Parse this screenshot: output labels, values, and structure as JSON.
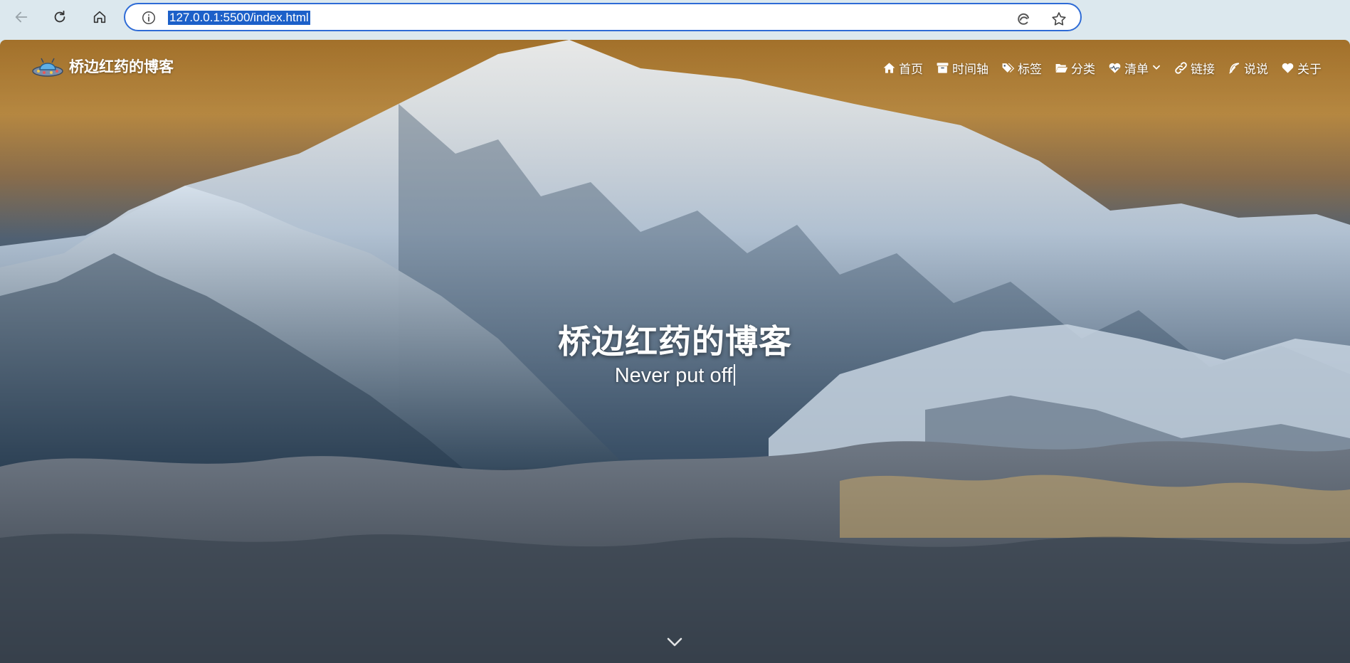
{
  "browser": {
    "url": "127.0.0.1:5500/index.html"
  },
  "site": {
    "title": "桥边红药的博客"
  },
  "menu": {
    "items": [
      {
        "label": "首页",
        "icon": "home-icon"
      },
      {
        "label": "时间轴",
        "icon": "archive-icon"
      },
      {
        "label": "标签",
        "icon": "tags-icon"
      },
      {
        "label": "分类",
        "icon": "folder-open-icon"
      },
      {
        "label": "清单",
        "icon": "heartbeat-icon"
      },
      {
        "label": "链接",
        "icon": "link-icon"
      },
      {
        "label": "说说",
        "icon": "feather-icon"
      },
      {
        "label": "关于",
        "icon": "heart-icon"
      }
    ]
  },
  "hero": {
    "title": "桥边红药的博客",
    "subtitle": "Never put off"
  },
  "colors": {
    "address_border": "#2e6bd6",
    "url_highlight": "#1c60c9",
    "sky_top": "#b07a2e",
    "text": "#ffffff"
  }
}
